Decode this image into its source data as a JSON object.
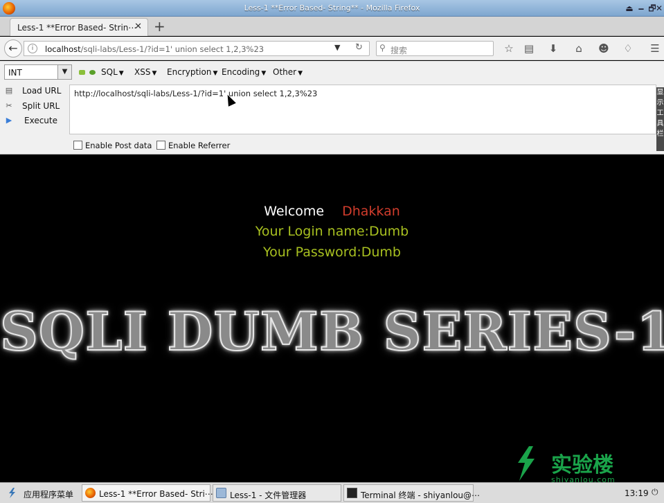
{
  "window": {
    "title": "Less-1 **Error Based- String** - Mozilla Firefox",
    "controls": [
      "⏏",
      "🗕",
      "🗗",
      "✕"
    ]
  },
  "tab": {
    "label": "Less-1 **Error Based- Strin⋯",
    "close": "✕",
    "new_tab": "+"
  },
  "navbar": {
    "url_host": "localhost",
    "url_path": "/sqli-labs/Less-1/?id=1' union select  1,2,3%23",
    "search_placeholder": "搜索"
  },
  "hackbar": {
    "select_value": "INT",
    "menus": [
      "SQL",
      "XSS",
      "Encryption",
      "Encoding",
      "Other"
    ],
    "actions": [
      "Load URL",
      "Split URL",
      "Execute"
    ],
    "url_value": "http://localhost/sqli-labs/Less-1/?id=1' union select  1,2,3%23",
    "checkboxes": [
      "Enable Post data",
      "Enable Referrer"
    ],
    "sidetab_chars": [
      "显",
      "示",
      "工",
      "具",
      "栏"
    ]
  },
  "page": {
    "welcome": "Welcome",
    "name": "Dhakkan",
    "login_line": "Your Login name:Dumb",
    "password_line": "Your Password:Dumb",
    "banner": "SQLI DUMB SERIES-1",
    "logo_text": "实验楼",
    "logo_sub": "shiyanlou.com"
  },
  "taskbar": {
    "menu": "应用程序菜单",
    "items": [
      "Less-1 **Error Based- Stri⋯",
      "Less-1 - 文件管理器",
      "Terminal 终端 - shiyanlou@⋯"
    ],
    "clock": "13:19"
  }
}
